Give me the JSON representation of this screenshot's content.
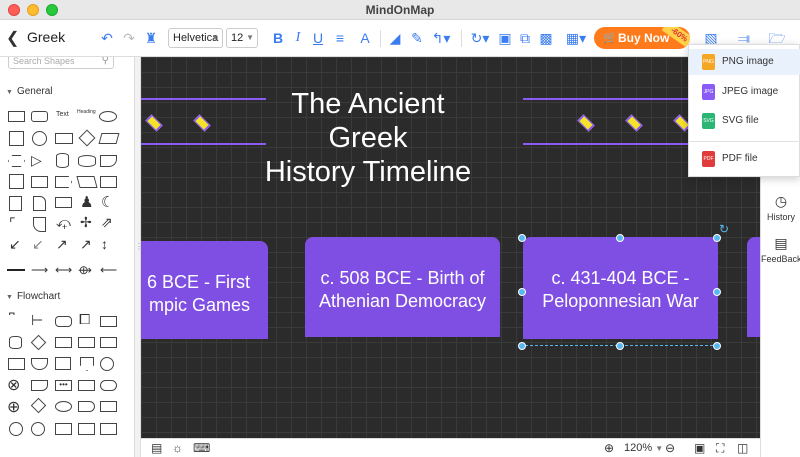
{
  "window": {
    "title": "MindOnMap"
  },
  "toolbar": {
    "doc_name": "Greek",
    "font": "Helvetica",
    "font_size": "12",
    "buy_now": "Buy Now",
    "discount": "-60%"
  },
  "left_panel": {
    "search_placeholder": "Search Shapes",
    "sections": [
      "General",
      "Flowchart"
    ],
    "text_shape_label": "Text",
    "heading_shape_label": "Heading"
  },
  "canvas": {
    "title_line1": "The Ancient Greek",
    "title_line2": "History Timeline",
    "cards": [
      {
        "line1": "6 BCE - First",
        "line2": "mpic Games"
      },
      {
        "line1": "c. 508 BCE - Birth of",
        "line2": "Athenian Democracy"
      },
      {
        "line1": "c. 431-404 BCE -",
        "line2": "Peloponnesian War"
      }
    ],
    "colors": {
      "card": "#7f4fe3",
      "diamond": "#f5e22a",
      "line": "#8a5cf5",
      "background": "#2b2b2b"
    }
  },
  "bottom_bar": {
    "zoom": "120%"
  },
  "right_panel": {
    "items": [
      "History",
      "FeedBack"
    ]
  },
  "export_menu": {
    "items": [
      {
        "label": "PNG image",
        "icon_text": "PNG",
        "color": "#f5a623"
      },
      {
        "label": "JPEG image",
        "icon_text": "JPG",
        "color": "#8a5cf5"
      },
      {
        "label": "SVG file",
        "icon_text": "SVG",
        "color": "#2bb673"
      },
      {
        "label": "PDF file",
        "icon_text": "PDF",
        "color": "#e03c3c"
      }
    ]
  }
}
